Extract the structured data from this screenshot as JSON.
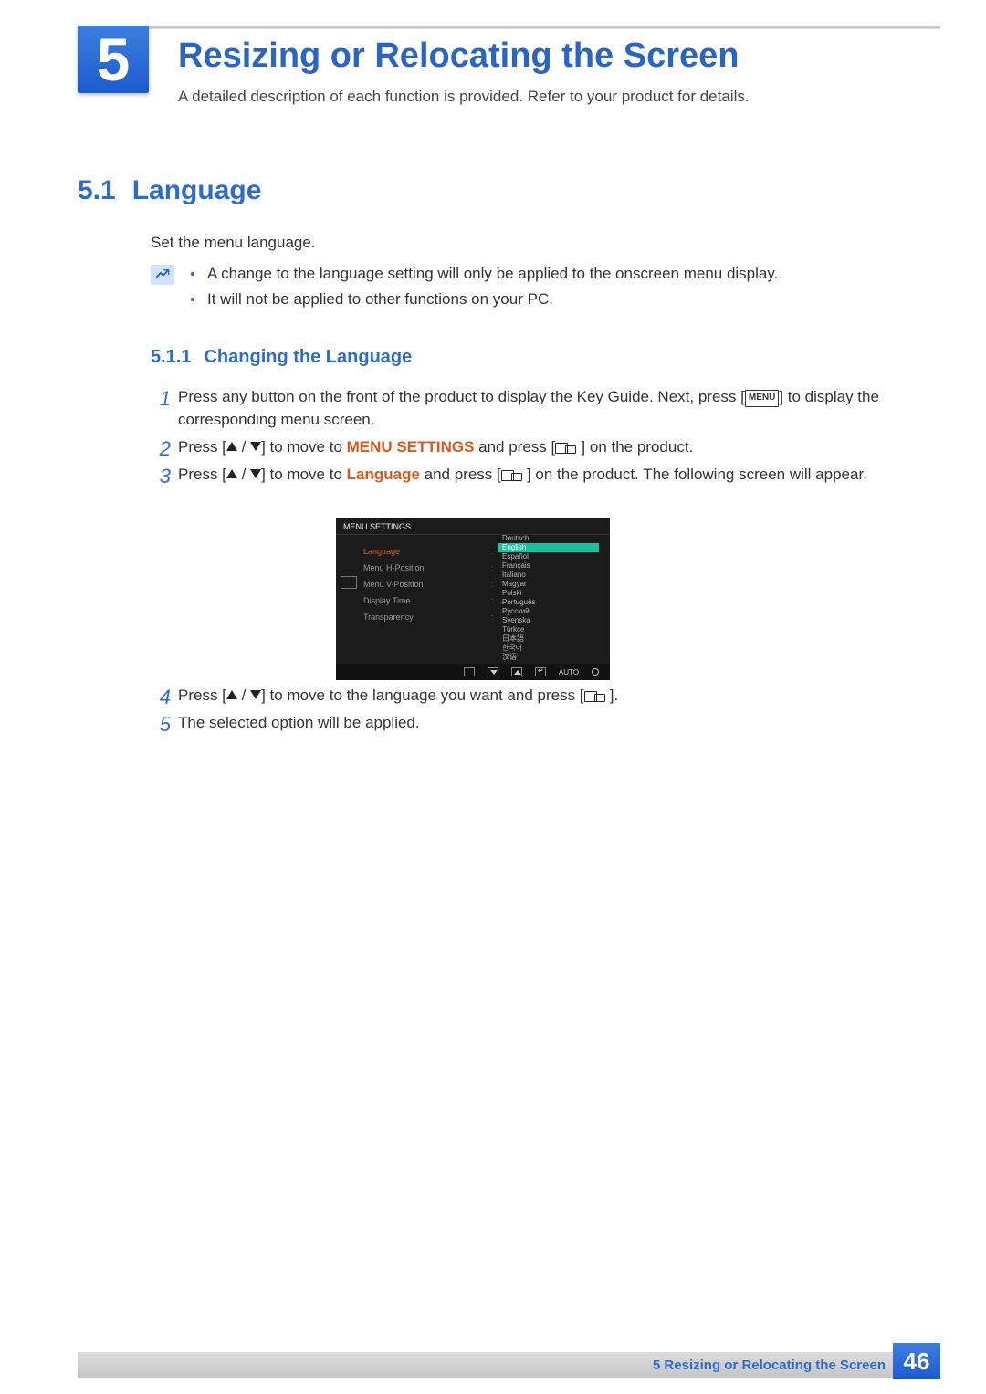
{
  "chapter": {
    "number": "5",
    "title": "Resizing or Relocating the Screen",
    "subtitle": "A detailed description of each function is provided. Refer to your product for details."
  },
  "section": {
    "number": "5.1",
    "title": "Language",
    "intro": "Set the menu language."
  },
  "notes": [
    "A change to the language setting will only be applied to the onscreen menu display.",
    "It will not be applied to other functions on your PC."
  ],
  "subsection": {
    "number": "5.1.1",
    "title": "Changing the Language"
  },
  "steps": {
    "s1a": "Press any button on the front of the product to display the Key Guide. Next, press [",
    "s1b": "] to display the corresponding menu screen.",
    "menu_key": "MENU",
    "s2a": "Press [",
    "s2b": "] to move to ",
    "s2c": " and press [",
    "s2d": "] on the product.",
    "s2_accent": "MENU SETTINGS",
    "s3a": "Press [",
    "s3b": "] to move to ",
    "s3c": " and press [",
    "s3d": "] on the product. The following screen will appear.",
    "s3_accent": "Language",
    "s4a": "Press [",
    "s4b": "] to move to the language you want and press [",
    "s4c": "].",
    "s5": "The selected option will be applied."
  },
  "osd": {
    "title": "MENU SETTINGS",
    "left": [
      "Language",
      "Menu H-Position",
      "Menu V-Position",
      "Display Time",
      "Transparency"
    ],
    "right": [
      "Deutsch",
      "English",
      "Español",
      "Français",
      "Italiano",
      "Magyar",
      "Polski",
      "Português",
      "Русский",
      "Svenska",
      "Türkçe",
      "日本語",
      "한국어",
      "汉语"
    ],
    "selected_right": "English",
    "auto": "AUTO"
  },
  "footer": {
    "label": "5 Resizing or Relocating the Screen",
    "page": "46"
  }
}
